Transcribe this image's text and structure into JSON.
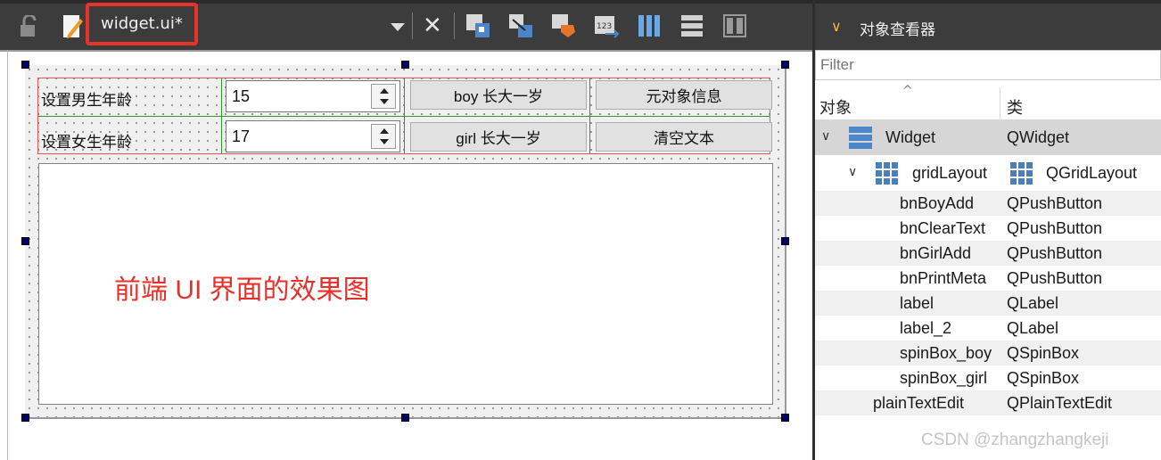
{
  "toolbar": {
    "file_name": "widget.ui*",
    "icons": [
      "lock-icon",
      "edit-icon",
      "dropdown-icon",
      "close-icon",
      "edit-widgets-icon",
      "edit-signals-icon",
      "edit-buddies-icon",
      "edit-tab-order-icon",
      "layout-horizontal-icon",
      "layout-vertical-icon",
      "break-layout-icon"
    ]
  },
  "form": {
    "row1_label": "设置男生年龄",
    "row2_label": "设置女生年龄",
    "spin_boy_value": "15",
    "spin_girl_value": "17",
    "btn_boy": "boy 长大一岁",
    "btn_meta": "元对象信息",
    "btn_girl": "girl 长大一岁",
    "btn_clear": "清空文本",
    "annotation": "前端  UI 界面的效果图"
  },
  "inspector": {
    "title": "对象查看器",
    "filter_placeholder": "Filter",
    "col_object": "对象",
    "col_class": "类",
    "rows": [
      {
        "name": "Widget",
        "cls": "QWidget"
      },
      {
        "name": "gridLayout",
        "cls": "QGridLayout"
      },
      {
        "name": "bnBoyAdd",
        "cls": "QPushButton"
      },
      {
        "name": "bnClearText",
        "cls": "QPushButton"
      },
      {
        "name": "bnGirlAdd",
        "cls": "QPushButton"
      },
      {
        "name": "bnPrintMeta",
        "cls": "QPushButton"
      },
      {
        "name": "label",
        "cls": "QLabel"
      },
      {
        "name": "label_2",
        "cls": "QLabel"
      },
      {
        "name": "spinBox_boy",
        "cls": "QSpinBox"
      },
      {
        "name": "spinBox_girl",
        "cls": "QSpinBox"
      },
      {
        "name": "plainTextEdit",
        "cls": "QPlainTextEdit"
      }
    ]
  },
  "watermark": "CSDN @zhangzhangkeji",
  "colors": {
    "highlight_red": "#e8322a",
    "layout_red": "#e85454",
    "layout_green": "#2a9a2a",
    "chevron": "#f2b636"
  }
}
